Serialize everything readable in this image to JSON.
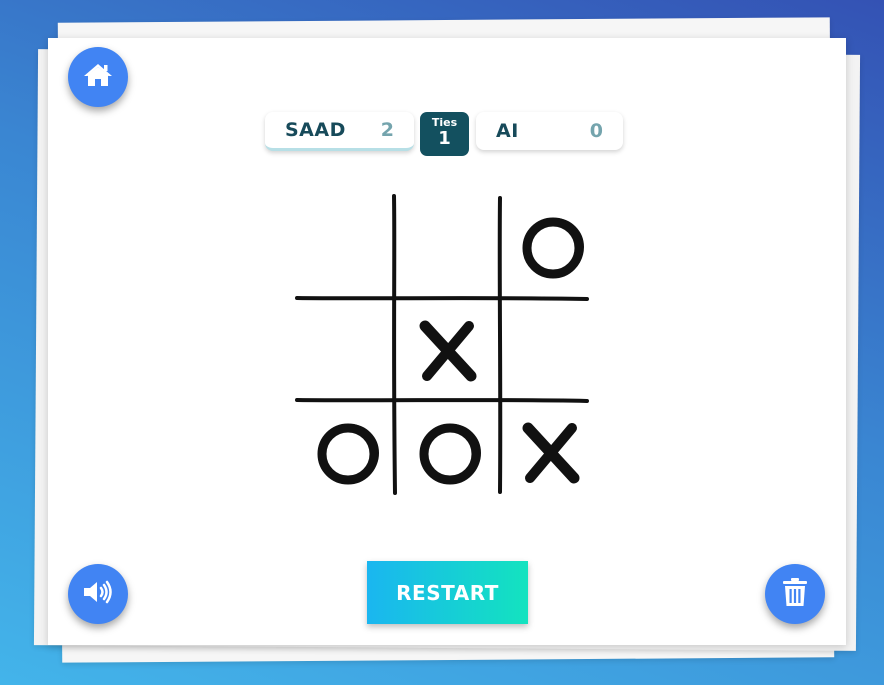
{
  "scoreboard": {
    "player1": {
      "name": "SAAD",
      "score": "2"
    },
    "ties": {
      "label": "Ties",
      "value": "1"
    },
    "player2": {
      "name": "AI",
      "score": "0"
    }
  },
  "board": {
    "cells": [
      "",
      "",
      "O",
      "",
      "X",
      "",
      "O",
      "O",
      "X"
    ]
  },
  "controls": {
    "restart_label": "RESTART",
    "home_icon": "home-icon",
    "sound_icon": "volume-icon",
    "trash_icon": "trash-icon"
  },
  "colors": {
    "accent_blue": "#4184f3",
    "ties_bg": "#13505f",
    "restart_gradient_start": "#1ab6f0",
    "restart_gradient_end": "#13e3bf"
  }
}
